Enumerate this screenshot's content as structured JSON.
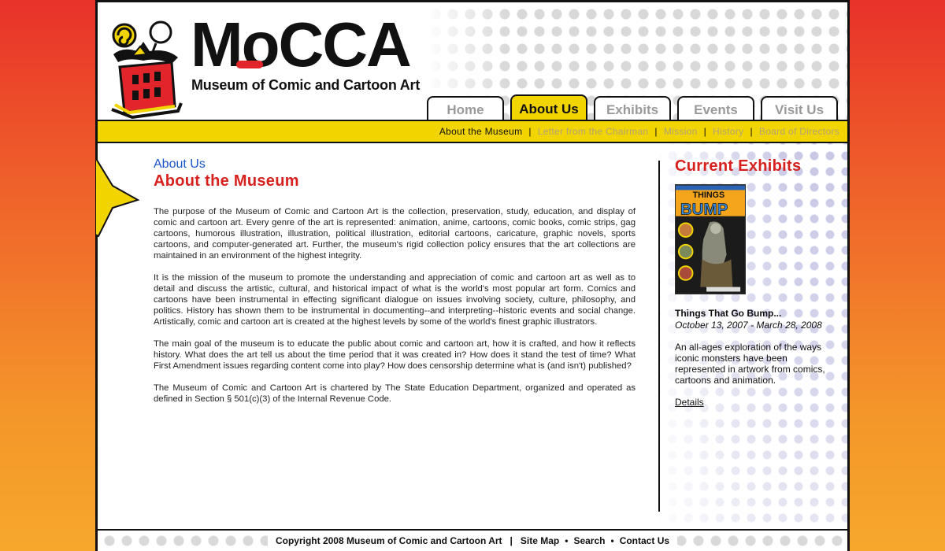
{
  "logo": {
    "name": "MoCCA",
    "subtitle": "Museum of Comic and Cartoon Art"
  },
  "tabs": [
    {
      "label": "Home",
      "active": false
    },
    {
      "label": "About Us",
      "active": true
    },
    {
      "label": "Exhibits",
      "active": false
    },
    {
      "label": "Events",
      "active": false
    },
    {
      "label": "Visit Us",
      "active": false
    }
  ],
  "subnav": [
    {
      "label": "About the Museum",
      "active": true
    },
    {
      "label": "Letter from the Chairman",
      "active": false
    },
    {
      "label": "Mission",
      "active": false
    },
    {
      "label": "History",
      "active": false
    },
    {
      "label": "Board of Directors",
      "active": false
    }
  ],
  "main": {
    "breadcrumb": "About Us",
    "title": "About the Museum",
    "paragraphs": [
      "The purpose of the Museum of Comic and Cartoon Art is the collection, preservation, study, education, and display of comic and cartoon art. Every genre of the art is represented: animation, anime, cartoons, comic books, comic strips, gag cartoons, humorous illustration, illustration, political illustration, editorial cartoons, caricature, graphic novels, sports cartoons, and computer-generated art. Further, the museum's rigid collection policy ensures that the art collections are maintained in an environment of the highest integrity.",
      "It is the mission of the museum to promote the understanding and appreciation of comic and cartoon art as well as to detail and discuss the artistic, cultural, and historical impact of what is the world's most popular art form. Comics and cartoons have been instrumental in effecting significant dialogue on issues involving society, culture, philosophy, and politics. History has shown them to be instrumental in documenting--and interpreting--historic events and social change. Artistically, comic and cartoon art is created at the highest levels by some of the world's finest graphic illustrators.",
      "The main goal of the museum is to educate the public about comic and cartoon art, how it is crafted, and how it reflects history. What does the art tell us about the time period that it was created in? How does it stand the test of time? What First Amendment issues regarding content come into play? How does censorship determine what is (and isn't) published?",
      "The Museum of Comic and Cartoon Art is chartered by The State Education Department, organized and operated as defined in Section § 501(c)(3) of the Internal Revenue Code."
    ]
  },
  "sidebar": {
    "title": "Current Exhibits",
    "cover_text": {
      "top": "THINGS",
      "main": "BUMP"
    },
    "exhibit_name": "Things That Go Bump...",
    "exhibit_dates": "October 13, 2007 - March 28, 2008",
    "exhibit_description": "An all-ages exploration of the ways iconic monsters have been represented in artwork from comics, cartoons and animation.",
    "details_label": "Details"
  },
  "footer": {
    "copyright": "Copyright 2008 Museum of Comic and Cartoon Art",
    "separator": "|",
    "links": [
      "Site Map",
      "Search",
      "Contact Us"
    ],
    "bullet": "•"
  },
  "colors": {
    "accent_yellow": "#f1d400",
    "title_red": "#d7211e",
    "breadcrumb_blue": "#1a56c8",
    "inactive_subnav": "#b3a472"
  }
}
